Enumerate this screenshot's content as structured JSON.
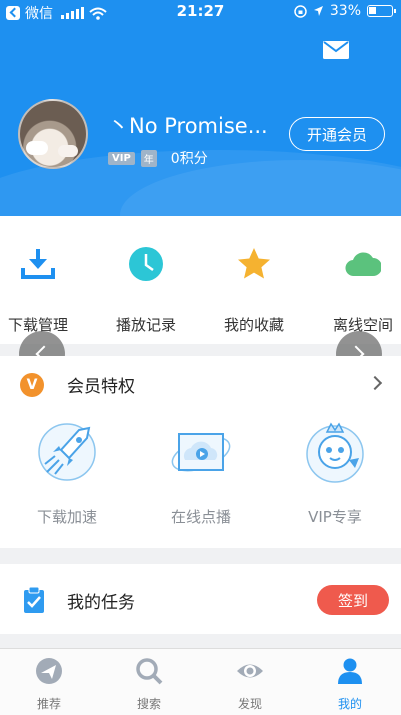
{
  "status_bar": {
    "carrier": "微信",
    "time": "21:27",
    "battery": "33%"
  },
  "profile": {
    "username": "丶No Promise...",
    "vip_badge": "VIP",
    "year_badge": "年",
    "points": "0积分",
    "open_vip_button": "开通会员"
  },
  "quick_actions": [
    {
      "label": "下载管理",
      "icon": "download-icon"
    },
    {
      "label": "播放记录",
      "icon": "clock-icon"
    },
    {
      "label": "我的收藏",
      "icon": "star-icon"
    },
    {
      "label": "离线空间",
      "icon": "cloud-icon"
    }
  ],
  "vip_section": {
    "logo_text": "V",
    "title": "会员特权",
    "privileges": [
      {
        "label": "下载加速",
        "icon": "rocket-icon"
      },
      {
        "label": "在线点播",
        "icon": "video-play-icon"
      },
      {
        "label": "VIP专享",
        "icon": "mascot-icon"
      }
    ]
  },
  "tasks": {
    "title": "我的任务",
    "checkin_button": "签到"
  },
  "tab_bar": [
    {
      "label": "推荐",
      "icon": "recommend-icon"
    },
    {
      "label": "搜索",
      "icon": "search-icon"
    },
    {
      "label": "发现",
      "icon": "eye-icon"
    },
    {
      "label": "我的",
      "icon": "user-icon",
      "active": true
    }
  ],
  "colors": {
    "brand_blue": "#1e90f0",
    "vip_orange": "#f2922c",
    "checkin_red": "#ef5a4d",
    "tab_inactive": "#8a8f96"
  }
}
